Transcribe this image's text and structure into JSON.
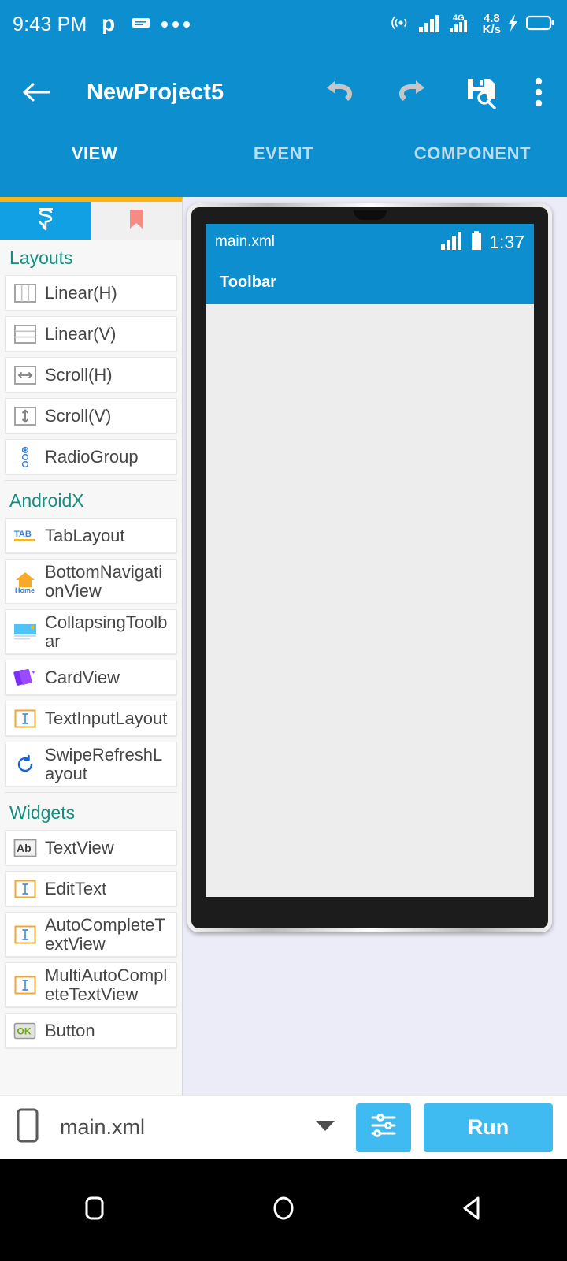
{
  "status_bar": {
    "clock": "9:43 PM",
    "left_icons": [
      "phonepe-icon",
      "message-icon",
      "more-dots-icon"
    ],
    "right_icons": [
      "hotspot-icon",
      "signal-sim1-icon",
      "signal-4g-icon",
      "charging-icon",
      "battery-icon"
    ],
    "network_speed_value": "4.8",
    "network_speed_unit": "K/s",
    "network_type": "4G"
  },
  "app_bar": {
    "back_icon": "arrow-back-icon",
    "title": "NewProject5",
    "actions": [
      {
        "name": "undo-icon"
      },
      {
        "name": "redo-icon"
      },
      {
        "name": "save-icon"
      },
      {
        "name": "overflow-menu-icon"
      }
    ]
  },
  "main_tabs": [
    {
      "label": "VIEW",
      "active": true
    },
    {
      "label": "EVENT",
      "active": false
    },
    {
      "label": "COMPONENT",
      "active": false
    }
  ],
  "palette": {
    "tabs": [
      {
        "name": "sketchware-logo-icon",
        "active": true
      },
      {
        "name": "bookmark-icon",
        "active": false
      }
    ],
    "accent_color": "#fcb415",
    "groups": [
      {
        "title": "Layouts",
        "items": [
          {
            "label": "Linear(H)",
            "icon": "linear-horizontal-icon"
          },
          {
            "label": "Linear(V)",
            "icon": "linear-vertical-icon"
          },
          {
            "label": "Scroll(H)",
            "icon": "scroll-horizontal-icon"
          },
          {
            "label": "Scroll(V)",
            "icon": "scroll-vertical-icon"
          },
          {
            "label": "RadioGroup",
            "icon": "radio-group-icon"
          }
        ]
      },
      {
        "title": "AndroidX",
        "items": [
          {
            "label": "TabLayout",
            "icon": "tab-layout-icon"
          },
          {
            "label": "BottomNavigationView",
            "icon": "bottom-navigation-icon"
          },
          {
            "label": "CollapsingToolbar",
            "icon": "collapsing-toolbar-icon"
          },
          {
            "label": "CardView",
            "icon": "card-view-icon"
          },
          {
            "label": "TextInputLayout",
            "icon": "text-input-layout-icon"
          },
          {
            "label": "SwipeRefreshLayout",
            "icon": "swipe-refresh-icon"
          }
        ]
      },
      {
        "title": "Widgets",
        "items": [
          {
            "label": "TextView",
            "icon": "text-view-icon"
          },
          {
            "label": "EditText",
            "icon": "edit-text-icon"
          },
          {
            "label": "AutoCompleteTextView",
            "icon": "autocomplete-text-view-icon"
          },
          {
            "label": "MultiAutoCompleteTextView",
            "icon": "multi-autocomplete-text-view-icon"
          },
          {
            "label": "Button",
            "icon": "button-icon"
          }
        ]
      }
    ]
  },
  "preview": {
    "status_file_name": "main.xml",
    "status_time": "1:37",
    "toolbar_title": "Toolbar",
    "toolbar_color": "#0d8ecf",
    "content_color": "#ededed"
  },
  "bottom_bar": {
    "device_icon": "phone-icon",
    "file_name": "main.xml",
    "dropdown_icon": "chevron-down-icon",
    "settings_icon": "sliders-icon",
    "run_label": "Run",
    "run_color": "#3fbbf2"
  },
  "nav_bar": {
    "buttons": [
      {
        "name": "recents-nav-button",
        "icon": "square-icon"
      },
      {
        "name": "home-nav-button",
        "icon": "circle-icon"
      },
      {
        "name": "back-nav-button",
        "icon": "triangle-back-icon"
      }
    ]
  }
}
